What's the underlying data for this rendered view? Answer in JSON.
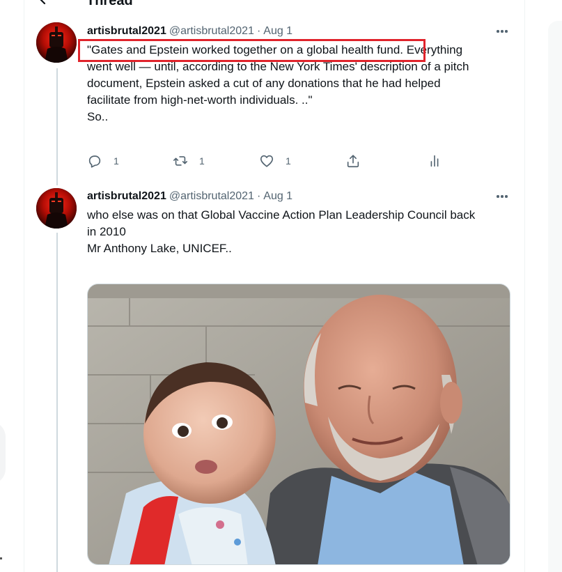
{
  "header": {
    "title": "Thread"
  },
  "tweets": [
    {
      "author_name": "artisbrutal2021",
      "author_handle": "@artisbrutal2021",
      "separator": "·",
      "time": "Aug 1",
      "text_lines": [
        "\"Gates and Epstein worked together on a global health fund. Everything",
        "went well — until, according to the New York Times' description of a pitch",
        "document, Epstein asked a cut of any donations that he had helped",
        "facilitate from high-net-worth individuals. ..\"",
        "",
        "So.."
      ],
      "stats": {
        "replies": "1",
        "retweets": "1",
        "likes": "1"
      }
    },
    {
      "author_name": "artisbrutal2021",
      "author_handle": "@artisbrutal2021",
      "separator": "·",
      "time": "Aug 1",
      "text_lines": [
        "who else was on that Global Vaccine Action Plan Leadership Council back",
        "in 2010",
        "",
        "Mr Anthony Lake, UNICEF.."
      ]
    }
  ],
  "annotation": {
    "color": "#e0232b"
  },
  "colors": {
    "text": "#0f1419",
    "secondary": "#536471",
    "thread_line": "#cfd9de"
  }
}
